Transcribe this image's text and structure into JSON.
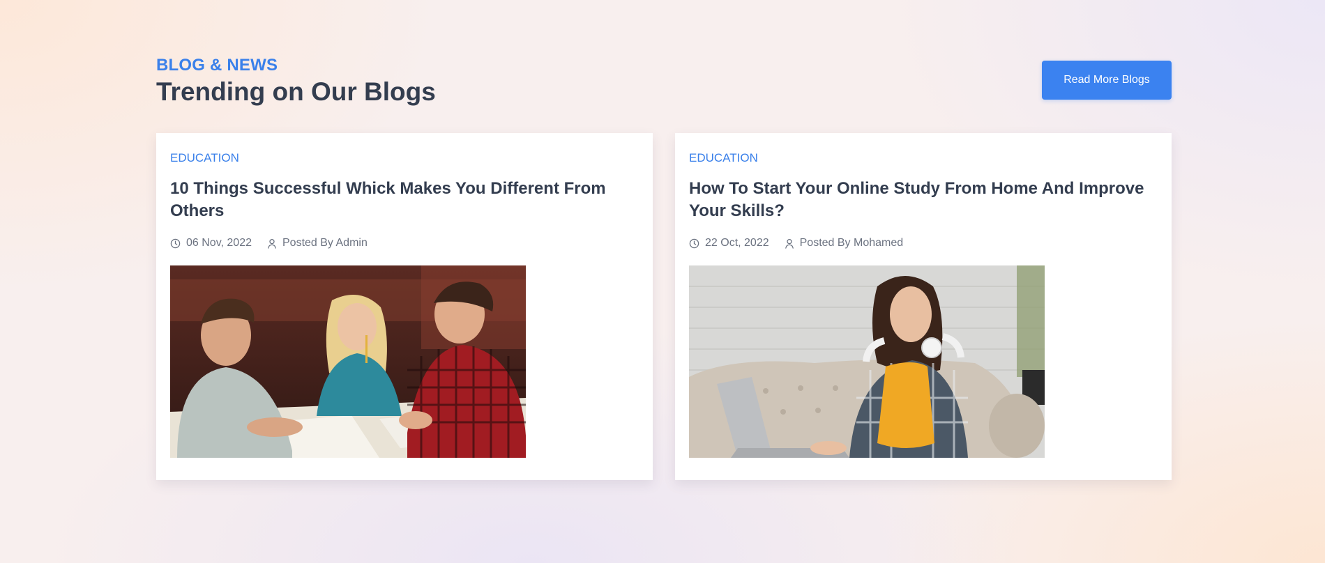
{
  "section": {
    "kicker": "BLOG & NEWS",
    "title": "Trending on Our Blogs",
    "cta_label": "Read More Blogs"
  },
  "posts": [
    {
      "category": "EDUCATION",
      "title": "10 Things Successful Whick Makes You Different From Others",
      "date": "06 Nov, 2022",
      "author": "Posted By Admin",
      "image_desc": "three-students-studying-photo"
    },
    {
      "category": "EDUCATION",
      "title": "How To Start Your Online Study From Home And Improve Your Skills?",
      "date": "22 Oct, 2022",
      "author": "Posted By Mohamed",
      "image_desc": "woman-with-laptop-photo"
    }
  ],
  "colors": {
    "accent": "#3b82f0",
    "heading": "#333d4f",
    "meta": "#6b7280"
  },
  "icons": {
    "date": "clock-icon",
    "author": "user-icon"
  }
}
